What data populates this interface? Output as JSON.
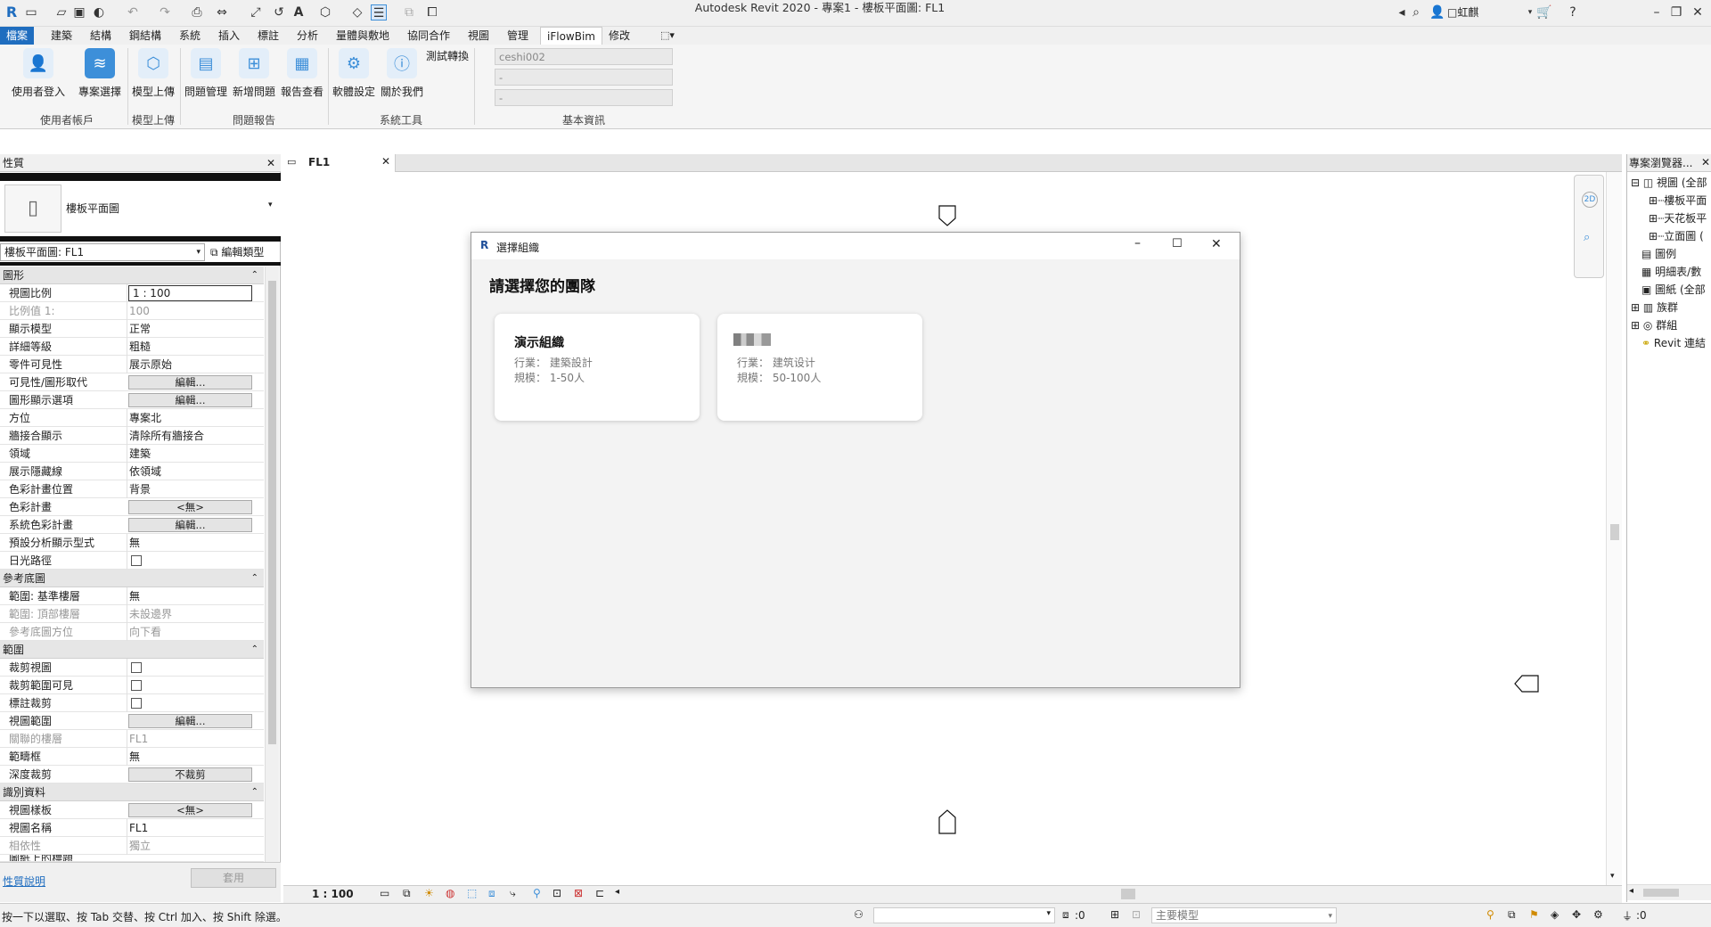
{
  "window": {
    "title": "Autodesk Revit 2020 - 專案1 - 樓板平面圖: FL1",
    "user": "□虹麒"
  },
  "ribbon_tabs": [
    "檔案",
    "建築",
    "結構",
    "鋼結構",
    "系統",
    "插入",
    "標註",
    "分析",
    "量體與敷地",
    "協同合作",
    "視圖",
    "管理",
    "iFlowBim",
    "修改"
  ],
  "ribbon": {
    "buttons": {
      "login": "使用者登入",
      "project_select": "專案選擇",
      "model_upload": "模型上傳",
      "issue_manage": "問題管理",
      "new_issue": "新增問題",
      "report_view": "報告查看",
      "software_settings": "軟體設定",
      "about": "關於我們",
      "test_convert": "測試轉換"
    },
    "groups": {
      "user_account": "使用者帳戶",
      "model_upload": "模型上傳",
      "issue_report": "問題報告",
      "system_tools": "系統工具",
      "basic_info": "基本資訊"
    },
    "info_fields": [
      "ceshi002",
      "-",
      "-"
    ]
  },
  "properties": {
    "header": "性質",
    "type_name": "樓板平面圖",
    "instance_select": "樓板平面圖: FL1",
    "edit_type": "編輯類型",
    "sections": {
      "graphics": "圖形",
      "underlay": "參考底圖",
      "extents": "範圍",
      "identity": "識別資料"
    },
    "rows": {
      "view_scale": {
        "label": "視圖比例",
        "value": "1 : 100"
      },
      "scale_value": {
        "label": "比例值 1:",
        "value": "100"
      },
      "display_model": {
        "label": "顯示模型",
        "value": "正常"
      },
      "detail_level": {
        "label": "詳細等級",
        "value": "粗糙"
      },
      "parts_visibility": {
        "label": "零件可見性",
        "value": "展示原始"
      },
      "vg_overrides": {
        "label": "可見性/圖形取代",
        "value": "編輯..."
      },
      "graphic_options": {
        "label": "圖形顯示選項",
        "value": "編輯..."
      },
      "orientation": {
        "label": "方位",
        "value": "專案北"
      },
      "wall_join": {
        "label": "牆接合顯示",
        "value": "清除所有牆接合"
      },
      "discipline": {
        "label": "領域",
        "value": "建築"
      },
      "hidden_lines": {
        "label": "展示隱藏線",
        "value": "依領域"
      },
      "color_scheme_location": {
        "label": "色彩計畫位置",
        "value": "背景"
      },
      "color_scheme": {
        "label": "色彩計畫",
        "value": "<無>"
      },
      "system_color": {
        "label": "系統色彩計畫",
        "value": "編輯..."
      },
      "analysis_display": {
        "label": "預設分析顯示型式",
        "value": "無"
      },
      "sun_path": {
        "label": "日光路徑",
        "value": ""
      },
      "range_base": {
        "label": "範圍: 基準樓層",
        "value": "無"
      },
      "range_top": {
        "label": "範圍: 頂部樓層",
        "value": "未設邊界"
      },
      "underlay_orient": {
        "label": "參考底圖方位",
        "value": "向下看"
      },
      "crop_view": {
        "label": "裁剪視圖",
        "value": ""
      },
      "crop_visible": {
        "label": "裁剪範圍可見",
        "value": ""
      },
      "annotation_crop": {
        "label": "標註裁剪",
        "value": ""
      },
      "view_range": {
        "label": "視圖範圍",
        "value": "編輯..."
      },
      "assoc_level": {
        "label": "關聯的樓層",
        "value": "FL1"
      },
      "scope_box": {
        "label": "範疇框",
        "value": "無"
      },
      "depth_clip": {
        "label": "深度裁剪",
        "value": "不裁剪"
      },
      "view_template": {
        "label": "視圖樣板",
        "value": "<無>"
      },
      "view_name": {
        "label": "視圖名稱",
        "value": "FL1"
      },
      "dependency": {
        "label": "相依性",
        "value": "獨立"
      },
      "title_on_sheet": {
        "label": "圖紙上的標題",
        "value": ""
      }
    },
    "help_link": "性質說明",
    "apply": "套用"
  },
  "view_tab": "FL1",
  "browser": {
    "header": "專案瀏覽器...",
    "items": [
      "視圖 (全部",
      "樓板平面",
      "天花板平",
      "立面圖 (",
      "圖例",
      "明細表/數",
      "圖紙 (全部",
      "族群",
      "群組",
      "Revit 連結"
    ]
  },
  "dialog": {
    "title": "選擇組織",
    "heading": "請選擇您的團隊",
    "cards": [
      {
        "name": "演示組織",
        "industry": "行業：  建築設計",
        "size": "規模：  1-50人"
      },
      {
        "name": "",
        "industry": "行業：  建筑设计",
        "size": "規模：  50-100人"
      }
    ]
  },
  "view_control": {
    "scale": "1 : 100"
  },
  "status": {
    "hint": "按一下以選取、按 Tab 交替、按 Ctrl 加入、按 Shift 除選。",
    "workset_count": ":0",
    "model": "主要模型",
    "filter_count": ":0"
  },
  "colors": {
    "accent": "#1f6dbf",
    "icon_blue": "#3d8fd9"
  }
}
